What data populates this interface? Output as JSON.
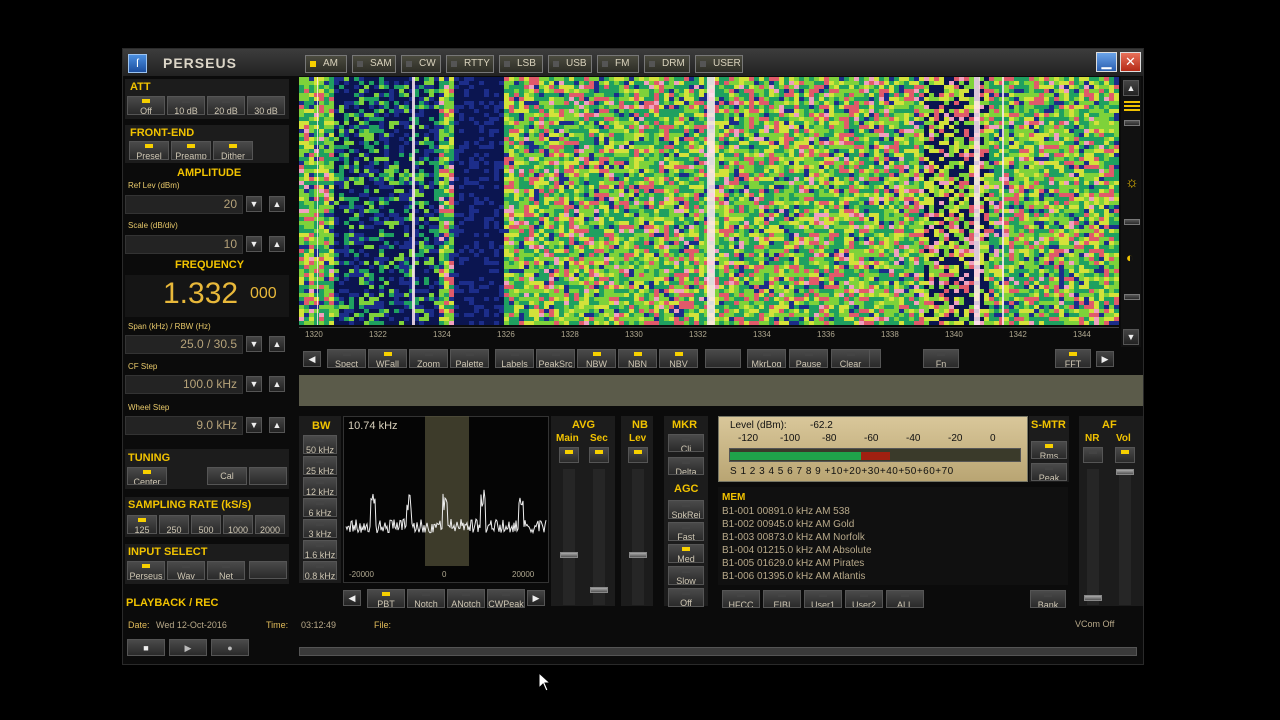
{
  "window": {
    "title": "PERSEUS",
    "logo": "perseus-logo",
    "minimize_glyph": "▁",
    "close_glyph": "✕"
  },
  "att": {
    "title": "ATT",
    "buttons": [
      {
        "label": "Off",
        "on": true
      },
      {
        "label": "10 dB",
        "on": false
      },
      {
        "label": "20 dB",
        "on": false
      },
      {
        "label": "30 dB",
        "on": false
      }
    ]
  },
  "frontend": {
    "title": "FRONT-END",
    "buttons": [
      {
        "label": "Presel",
        "on": true
      },
      {
        "label": "Preamp",
        "on": true
      },
      {
        "label": "Dither",
        "on": true
      }
    ]
  },
  "amplitude": {
    "title": "AMPLITUDE",
    "ref_label": "Ref Lev (dBm)",
    "ref_value": "20",
    "scale_label": "Scale (dB/div)",
    "scale_value": "10"
  },
  "frequency": {
    "title": "FREQUENCY",
    "main": "1.332",
    "sub": "000",
    "span_label": "Span (kHz) / RBW (Hz)",
    "span_value": "25.0 / 30.5",
    "cf_label": "CF Step",
    "cf_value": "100.0 kHz",
    "wheel_label": "Wheel Step",
    "wheel_value": "9.0 kHz"
  },
  "tuning": {
    "title": "TUNING",
    "center": "Center",
    "cal": "Cal"
  },
  "sampling": {
    "title": "SAMPLING RATE (kS/s)",
    "rates": [
      {
        "label": "125",
        "on": true
      },
      {
        "label": "250",
        "on": false
      },
      {
        "label": "500",
        "on": false
      },
      {
        "label": "1000",
        "on": false
      },
      {
        "label": "2000",
        "on": false
      }
    ]
  },
  "input": {
    "title": "INPUT SELECT",
    "buttons": [
      {
        "label": "Perseus",
        "on": true
      },
      {
        "label": "Wav",
        "on": false
      },
      {
        "label": "Net",
        "on": false
      }
    ]
  },
  "playback": {
    "title": "PLAYBACK / REC",
    "date_label": "Date:",
    "date": "Wed 12-Oct-2016",
    "time_label": "Time:",
    "time": "03:12:49",
    "file_label": "File:",
    "vcom": "VCom Off"
  },
  "ticks": [
    "1320",
    "1322",
    "1324",
    "1326",
    "1328",
    "1330",
    "1332",
    "1334",
    "1336",
    "1338",
    "1340",
    "1342",
    "1344"
  ],
  "toolbar": {
    "left": [
      "Spect",
      "WFall",
      "Zoom",
      "Palette"
    ],
    "mid": [
      "Labels",
      "PeakSrc",
      "NBW",
      "NBN",
      "NBV"
    ],
    "right": [
      "MkrLog",
      "Pause",
      "Clear"
    ],
    "fn": "Fn",
    "fft": "FFT",
    "prev": "◀",
    "next": "▶"
  },
  "modes": [
    {
      "label": "AM",
      "on": true
    },
    {
      "label": "SAM",
      "on": false
    },
    {
      "label": "CW",
      "on": false
    },
    {
      "label": "RTTY",
      "on": false
    },
    {
      "label": "LSB",
      "on": false
    },
    {
      "label": "USB",
      "on": false
    },
    {
      "label": "FM",
      "on": false
    },
    {
      "label": "DRM",
      "on": false
    },
    {
      "label": "USER",
      "on": false
    }
  ],
  "bw": {
    "title": "BW",
    "items": [
      "50 kHz",
      "25 kHz",
      "12 kHz",
      "6 kHz",
      "3 kHz",
      "1.6 kHz",
      "0.8 kHz"
    ],
    "readout": "10.74 kHz",
    "xticks": [
      "-20000",
      "0",
      "20000"
    ]
  },
  "filter": {
    "buttons": [
      "PBT",
      "Notch",
      "ANotch",
      "CWPeak"
    ]
  },
  "avg": {
    "title": "AVG",
    "main": "Main",
    "sec": "Sec"
  },
  "nb": {
    "title": "NB",
    "lev": "Lev"
  },
  "mkr": {
    "title": "MKR",
    "cli": "Cli",
    "delta": "Delta"
  },
  "agc": {
    "title": "AGC",
    "items": [
      "SpkRej",
      "Fast",
      "Med",
      "Slow",
      "Off"
    ]
  },
  "smeter": {
    "level_label": "Level (dBm):",
    "level_value": "-62.2",
    "dbm_scale": [
      "-120",
      "-100",
      "-80",
      "-60",
      "-40",
      "-20",
      "0"
    ],
    "s_scale": "S 1 2 3 4 5 6 7 8 9 +10+20+30+40+50+60+70",
    "reading_fraction": 0.55,
    "title": "S-MTR",
    "rms": "Rms",
    "peak": "Peak"
  },
  "af": {
    "title": "AF",
    "nr": "NR",
    "vol": "Vol"
  },
  "mem": {
    "title": "MEM",
    "rows": [
      "B1-001 00891.0 kHz  AM  538",
      "B1-002 00945.0 kHz  AM  Gold",
      "B1-003 00873.0 kHz  AM  Norfolk",
      "B1-004 01215.0 kHz  AM  Absolute",
      "B1-005 01629.0 kHz  AM  Pirates",
      "B1-006 01395.0 kHz  AM  Atlantis"
    ],
    "buttons": [
      "HFCC",
      "EIBI",
      "User1",
      "User2",
      "ALL"
    ],
    "bank": "Bank"
  },
  "side_icons": [
    "brightness-icon",
    "contrast-icon"
  ],
  "colors": {
    "accent": "#f2c300",
    "indicator": "#f7d000",
    "text": "#cfc7b4",
    "meter_green": "#1fa34a",
    "meter_red": "#a02010"
  }
}
